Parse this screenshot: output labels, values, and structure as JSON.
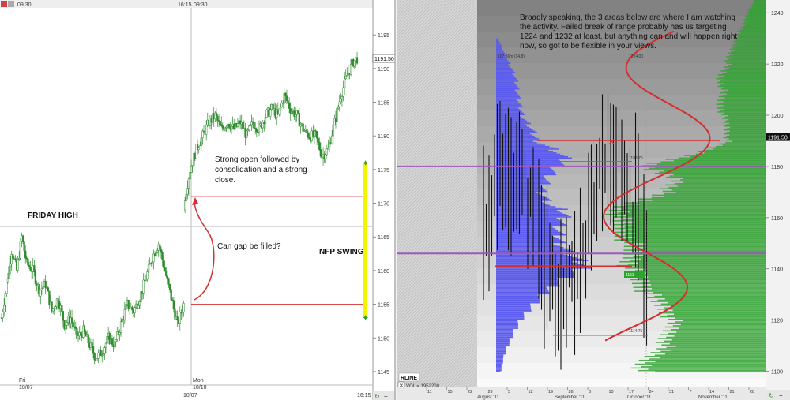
{
  "colors": {
    "left_bg": "#ffffff",
    "candle": "#2e8b2e",
    "red_line": "#d23030",
    "purple_line": "#9b59b6",
    "blue_profile": "#5b5bf0",
    "green_profile": "#2ea32e",
    "yellow_bar": "#f4f400",
    "axis_text": "#333333"
  },
  "left_chart": {
    "top_labels": {
      "left_time": "09:30",
      "mid_time": "16:15",
      "right_time": "09:30"
    },
    "price_current": "1191.50",
    "price_ticks": [
      "1195",
      "1190",
      "1185",
      "1180",
      "1175",
      "1170",
      "1165",
      "1160",
      "1155",
      "1150",
      "1145"
    ],
    "x_labels": [
      {
        "line1": "Fri",
        "line2": "10/07"
      },
      {
        "line1": "Mon",
        "line2": "10/10"
      }
    ],
    "bottom_date": "10/07",
    "bottom_time": "16:15",
    "annotations": {
      "friday_high": "FRIDAY HIGH",
      "nfp_swing": "NFP SWING",
      "strong_open": "Strong open followed by consolidation and a strong close.",
      "can_gap": "Can gap be filled?"
    }
  },
  "right_chart": {
    "commentary": "Broadly speaking, the 3 areas below are where I am watching the activity. Failed break of range probably has us targeting 1224 and 1232 at least, but anything can and will happen right now, so got to be flexible in your views.",
    "price_current": "1191.50",
    "price_ticks": [
      "1240",
      "1220",
      "1200",
      "1180",
      "1160",
      "1140",
      "1120",
      "1100"
    ],
    "small_labels": {
      "top_left": "107.56m (34.8)",
      "top_right": "1224.00",
      "mid": "1183.75",
      "low": "1114.75",
      "box": "1153"
    },
    "legend": {
      "name": "RLINE",
      "vol": "VOL = 1952200"
    },
    "month_labels": [
      "August '11",
      "September '11",
      "October '11",
      "November '11"
    ],
    "day_ticks": [
      "11",
      "15",
      "22",
      "29",
      "5",
      "12",
      "19",
      "26",
      "3",
      "10",
      "17",
      "24",
      "31",
      "7",
      "14",
      "21",
      "28"
    ]
  },
  "chart_data": [
    {
      "type": "candlestick",
      "title": "",
      "xlabel": "",
      "ylabel": "",
      "ylim": [
        1143,
        1199
      ],
      "sessions": [
        "Fri 10/07",
        "Mon 10/10"
      ],
      "close_path": [
        [
          0,
          1153
        ],
        [
          4,
          1158
        ],
        [
          8,
          1163
        ],
        [
          12,
          1160
        ],
        [
          16,
          1165
        ],
        [
          20,
          1161
        ],
        [
          25,
          1160
        ],
        [
          30,
          1157
        ],
        [
          35,
          1158
        ],
        [
          40,
          1154
        ],
        [
          45,
          1156
        ],
        [
          50,
          1152
        ],
        [
          55,
          1153
        ],
        [
          60,
          1150
        ],
        [
          65,
          1151
        ],
        [
          70,
          1149
        ],
        [
          75,
          1147
        ],
        [
          80,
          1148
        ],
        [
          85,
          1150
        ],
        [
          90,
          1149
        ],
        [
          95,
          1152
        ],
        [
          100,
          1155
        ],
        [
          105,
          1154
        ],
        [
          110,
          1156
        ],
        [
          115,
          1159
        ],
        [
          120,
          1162
        ],
        [
          125,
          1164
        ],
        [
          130,
          1160
        ],
        [
          135,
          1156
        ],
        [
          140,
          1152
        ],
        [
          145,
          1155
        ],
        [
          146,
          1171
        ],
        [
          150,
          1175
        ],
        [
          155,
          1178
        ],
        [
          160,
          1180
        ],
        [
          165,
          1182
        ],
        [
          170,
          1183
        ],
        [
          175,
          1181
        ],
        [
          180,
          1182
        ],
        [
          185,
          1181
        ],
        [
          190,
          1182
        ],
        [
          195,
          1180
        ],
        [
          200,
          1182
        ],
        [
          205,
          1181
        ],
        [
          210,
          1183
        ],
        [
          215,
          1184
        ],
        [
          220,
          1183
        ],
        [
          225,
          1186
        ],
        [
          230,
          1184
        ],
        [
          235,
          1183
        ],
        [
          240,
          1181
        ],
        [
          245,
          1180
        ],
        [
          250,
          1180
        ],
        [
          255,
          1177
        ],
        [
          260,
          1178
        ],
        [
          265,
          1182
        ],
        [
          270,
          1186
        ],
        [
          275,
          1189
        ],
        [
          280,
          1191
        ],
        [
          283,
          1191.5
        ]
      ],
      "levels": {
        "friday_high": 1166.5,
        "gap_top": 1171,
        "gap_bottom": 1155,
        "nfp_swing_high": 1176,
        "nfp_swing_low": 1153
      }
    },
    {
      "type": "volume_profile",
      "title": "",
      "ylim": [
        1094,
        1245
      ],
      "blue_profile": [
        [
          1100,
          6
        ],
        [
          1105,
          9
        ],
        [
          1110,
          15
        ],
        [
          1115,
          22
        ],
        [
          1120,
          32
        ],
        [
          1125,
          45
        ],
        [
          1130,
          62
        ],
        [
          1135,
          80
        ],
        [
          1140,
          112
        ],
        [
          1142,
          116
        ],
        [
          1145,
          98
        ],
        [
          1150,
          85
        ],
        [
          1155,
          80
        ],
        [
          1160,
          90
        ],
        [
          1163,
          88
        ],
        [
          1165,
          70
        ],
        [
          1170,
          60
        ],
        [
          1175,
          65
        ],
        [
          1180,
          80
        ],
        [
          1183,
          90
        ],
        [
          1186,
          80
        ],
        [
          1190,
          55
        ],
        [
          1195,
          45
        ],
        [
          1200,
          35
        ],
        [
          1205,
          30
        ],
        [
          1210,
          28
        ],
        [
          1215,
          25
        ],
        [
          1220,
          18
        ],
        [
          1225,
          10
        ],
        [
          1230,
          3
        ]
      ],
      "green_profile": [
        [
          1100,
          160
        ],
        [
          1105,
          150
        ],
        [
          1110,
          130
        ],
        [
          1115,
          125
        ],
        [
          1120,
          120
        ],
        [
          1125,
          130
        ],
        [
          1130,
          150
        ],
        [
          1135,
          160
        ],
        [
          1140,
          175
        ],
        [
          1145,
          170
        ],
        [
          1150,
          175
        ],
        [
          1155,
          180
        ],
        [
          1160,
          190
        ],
        [
          1165,
          180
        ],
        [
          1170,
          130
        ],
        [
          1175,
          110
        ],
        [
          1180,
          160
        ],
        [
          1185,
          90
        ],
        [
          1190,
          50
        ],
        [
          1195,
          50
        ],
        [
          1200,
          55
        ],
        [
          1205,
          60
        ],
        [
          1210,
          55
        ],
        [
          1215,
          60
        ],
        [
          1220,
          50
        ],
        [
          1225,
          45
        ],
        [
          1230,
          40
        ],
        [
          1235,
          30
        ],
        [
          1240,
          25
        ],
        [
          1245,
          15
        ]
      ],
      "levels": {
        "purple_upper": 1180,
        "purple_lower": 1146,
        "red_upper": 1190,
        "red_lower": 1141,
        "green_upper": 1182,
        "green_lower": 1114
      }
    }
  ]
}
